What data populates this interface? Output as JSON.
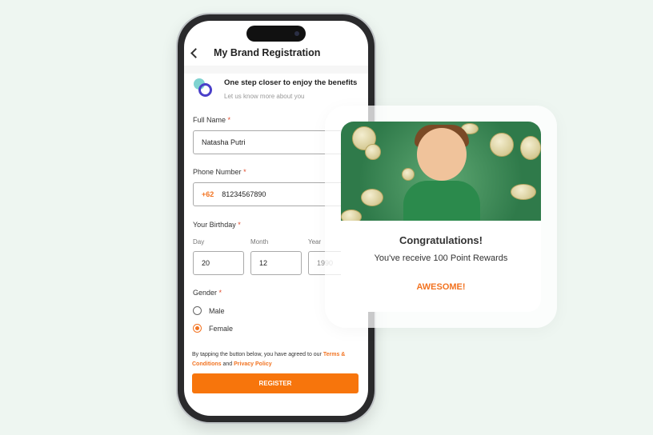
{
  "header": {
    "title": "My Brand Registration"
  },
  "intro": {
    "title": "One step closer to enjoy the benefits",
    "subtitle": "Let us know more about you"
  },
  "form": {
    "full_name": {
      "label": "Full Name",
      "required": "*",
      "value": "Natasha Putri"
    },
    "phone": {
      "label": "Phone Number",
      "required": "*",
      "prefix": "+62",
      "value": "81234567890"
    },
    "birthday": {
      "label": "Your Birthday",
      "required": "*",
      "day_label": "Day",
      "month_label": "Month",
      "year_label": "Year",
      "day": "20",
      "month": "12",
      "year": "1990"
    },
    "gender": {
      "label": "Gender",
      "required": "*",
      "options": [
        "Male",
        "Female"
      ],
      "selected": "Female"
    },
    "terms": {
      "prefix": "By tapping the button below, you have agreed to our ",
      "terms_link": "Terms & Conditions",
      "and": " and ",
      "privacy_link": "Privacy Policy"
    },
    "register_label": "REGISTER"
  },
  "popup": {
    "title": "Congratulations!",
    "message": "You've receive 100 Point Rewards",
    "button": "AWESOME!"
  },
  "colors": {
    "accent": "#f7750c",
    "background": "#eef6f1"
  }
}
